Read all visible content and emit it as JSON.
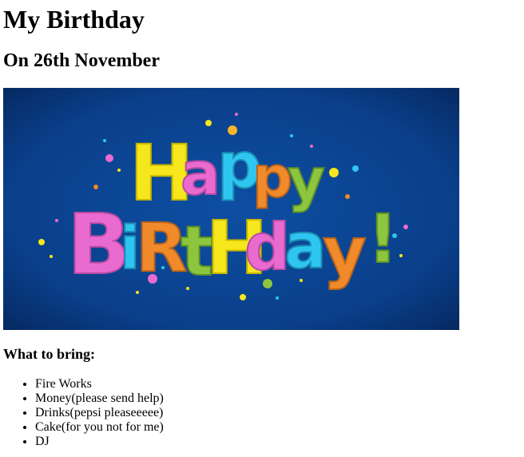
{
  "page": {
    "title": "My Birthday",
    "subtitle": "On 26th November"
  },
  "banner": {
    "line1": [
      "H",
      "a",
      "p",
      "p",
      "y"
    ],
    "line2": [
      "B",
      "i",
      "R",
      "t",
      "H",
      "d",
      "a",
      "y",
      "!"
    ],
    "colors": {
      "background": "#0a3f8a",
      "yellow": "#f5e71c",
      "pink": "#e96bd0",
      "cyan": "#2ec6f0",
      "orange": "#f08a2a",
      "green": "#8cc63f"
    }
  },
  "bring": {
    "heading": "What to bring:",
    "items": [
      "Fire Works",
      "Money(please send help)",
      "Drinks(pepsi pleaseeeee)",
      "Cake(for you not for me)",
      "DJ"
    ]
  }
}
